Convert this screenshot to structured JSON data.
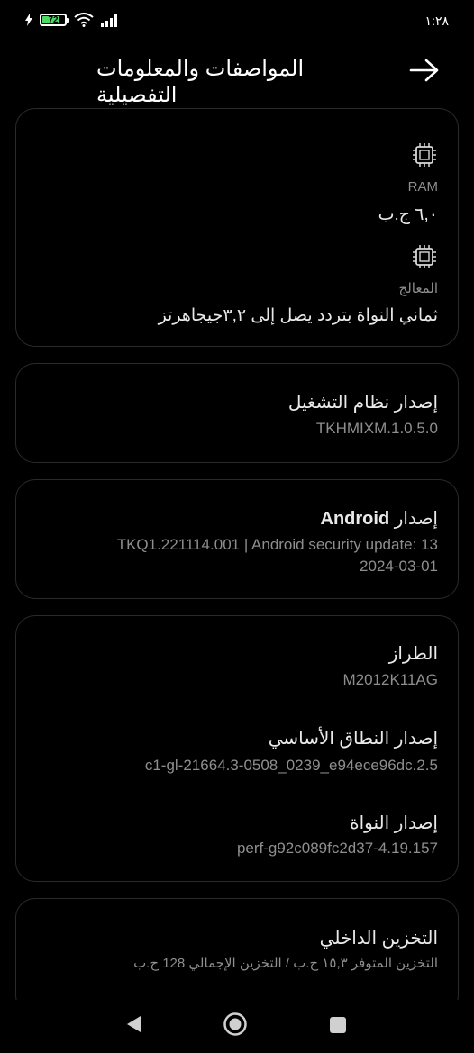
{
  "status_bar": {
    "time": "١:٢٨",
    "battery_level": "72"
  },
  "header": {
    "title": "المواصفات والمعلومات التفصيلية"
  },
  "specs": {
    "ram": {
      "label": "RAM",
      "value": "٦,٠ ج.ب"
    },
    "processor": {
      "label": "المعالج",
      "value": "ثماني النواة بتردد يصل إلى ٣,٢جيجاهرتز"
    }
  },
  "os": {
    "label": "إصدار نظام التشغيل",
    "value": "TKHMIXM.1.0.5.0"
  },
  "android": {
    "label_prefix": "إصدار",
    "label_bold": "Android",
    "value_line1": "TKQ1.221114.001 | Android security update: 13",
    "value_line2": "2024-03-01"
  },
  "device": {
    "model_label": "الطراز",
    "model_value": "M2012K11AG",
    "baseband_label": "إصدار النطاق الأساسي",
    "baseband_value": "c1-gl-21664.3-0508_0239_e94ece96dc.2.5",
    "kernel_label": "إصدار النواة",
    "kernel_value": "perf-g92c089fc2d37-4.19.157"
  },
  "storage": {
    "label": "التخزين الداخلي",
    "available": "التخزين المتوفر ١٥,٣ ج.ب",
    "separator": "/",
    "total": "التخزين الإجمالي 128 ج.ب"
  },
  "colors": {
    "background": "#000000",
    "card_border": "#2a2a2a",
    "battery": "#4cd964"
  }
}
